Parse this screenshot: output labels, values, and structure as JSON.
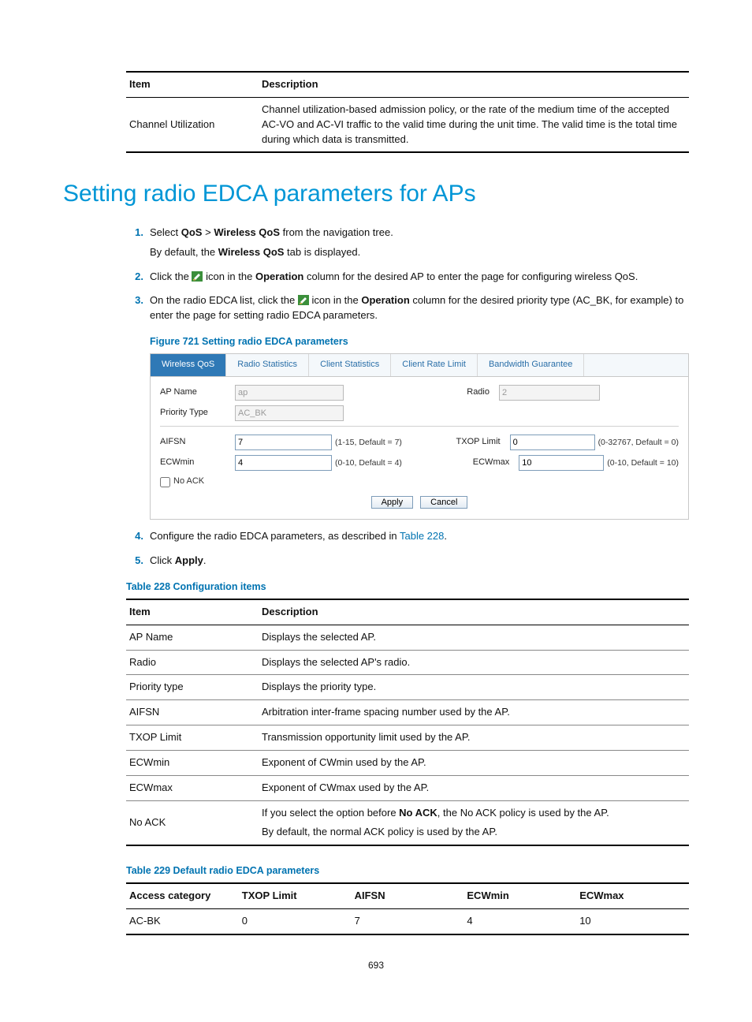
{
  "table_top": {
    "head": {
      "item": "Item",
      "desc": "Description"
    },
    "row": {
      "item": "Channel Utilization",
      "desc": "Channel utilization-based admission policy, or the rate of the medium time of the accepted AC-VO and AC-VI traffic to the valid time during the unit time. The valid time is the total time during which data is transmitted."
    }
  },
  "h1": "Setting radio EDCA parameters for APs",
  "steps": {
    "s1a": "Select ",
    "s1_qos": "QoS",
    "s1_gt": " > ",
    "s1_wqos": "Wireless QoS",
    "s1b": " from the navigation tree.",
    "s1p_a": "By default, the ",
    "s1p_b": "Wireless QoS",
    "s1p_c": " tab is displayed.",
    "s2a": "Click the ",
    "s2b": " icon in the ",
    "s2_op": "Operation",
    "s2c": " column for the desired AP to enter the page for configuring wireless QoS.",
    "s3a": "On the radio EDCA list, click the ",
    "s3b": " icon in the ",
    "s3_op": "Operation",
    "s3c": " column for the desired priority type (AC_BK, for example) to enter the page for setting radio EDCA parameters.",
    "s4a": "Configure the radio EDCA parameters, as described in ",
    "s4_link": "Table 228",
    "s4b": ".",
    "s5a": "Click ",
    "s5_apply": "Apply",
    "s5b": "."
  },
  "num1": "1.",
  "num2": "2.",
  "num3": "3.",
  "num4": "4.",
  "num5": "5.",
  "fig_caption": "Figure 721 Setting radio EDCA parameters",
  "fig": {
    "tabs": {
      "t0": "Wireless QoS",
      "t1": "Radio Statistics",
      "t2": "Client Statistics",
      "t3": "Client Rate Limit",
      "t4": "Bandwidth Guarantee"
    },
    "labels": {
      "apname": "AP Name",
      "radio": "Radio",
      "ptype": "Priority Type",
      "aifsn": "AIFSN",
      "txop": "TXOP Limit",
      "ecwmin": "ECWmin",
      "ecwmax": "ECWmax",
      "noack": "No ACK"
    },
    "vals": {
      "apname": "ap",
      "radio": "2",
      "ptype": "AC_BK",
      "aifsn": "7",
      "txop": "0",
      "ecwmin": "4",
      "ecwmax": "10"
    },
    "hints": {
      "aifsn": "(1-15, Default = 7)",
      "txop": "(0-32767, Default = 0)",
      "ecwmin": "(0-10, Default = 4)",
      "ecwmax": "(0-10, Default = 10)"
    },
    "btn_apply": "Apply",
    "btn_cancel": "Cancel"
  },
  "t228_caption": "Table 228 Configuration items",
  "t228": {
    "head": {
      "item": "Item",
      "desc": "Description"
    },
    "r0": {
      "item": "AP Name",
      "desc": "Displays the selected AP."
    },
    "r1": {
      "item": "Radio",
      "desc": "Displays the selected AP's radio."
    },
    "r2": {
      "item": "Priority type",
      "desc": "Displays the priority type."
    },
    "r3": {
      "item": "AIFSN",
      "desc": "Arbitration inter-frame spacing number used by the AP."
    },
    "r4": {
      "item": "TXOP Limit",
      "desc": "Transmission opportunity limit used by the AP."
    },
    "r5": {
      "item": "ECWmin",
      "desc": "Exponent of CWmin used by the AP."
    },
    "r6": {
      "item": "ECWmax",
      "desc": "Exponent of CWmax used by the AP."
    },
    "r7": {
      "item": "No ACK",
      "desc_a": "If you select the option before ",
      "desc_b": "No ACK",
      "desc_c": ", the No ACK policy is used by the AP.",
      "desc_d": "By default, the normal ACK policy is used by the AP."
    }
  },
  "t229_caption": "Table 229 Default radio EDCA parameters",
  "t229": {
    "head": {
      "c0": "Access category",
      "c1": "TXOP Limit",
      "c2": "AIFSN",
      "c3": "ECWmin",
      "c4": "ECWmax"
    },
    "r0": {
      "c0": "AC-BK",
      "c1": "0",
      "c2": "7",
      "c3": "4",
      "c4": "10"
    }
  },
  "page": "693"
}
